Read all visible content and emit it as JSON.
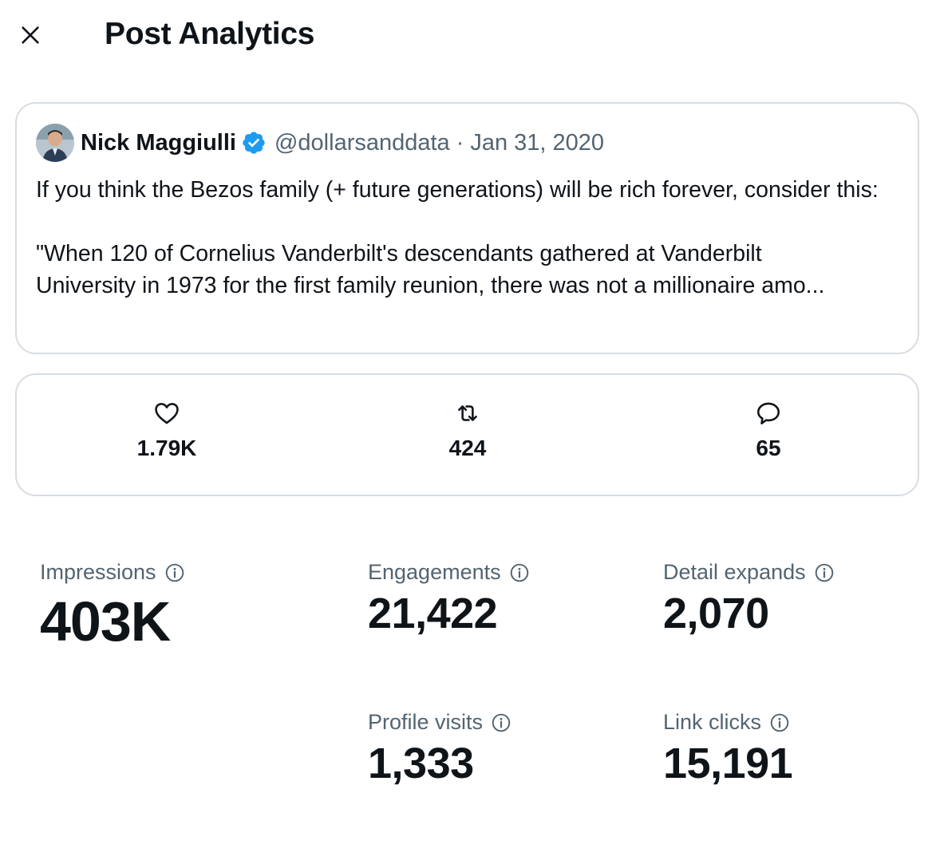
{
  "header": {
    "title": "Post Analytics",
    "close_icon": "close-icon"
  },
  "post": {
    "author_name": "Nick Maggiulli",
    "handle": "@dollarsanddata",
    "separator": "·",
    "date": "Jan 31, 2020",
    "verified_color": "#1d9bf0",
    "paragraph1": "If you think the Bezos family (+ future generations) will be rich forever, consider this:",
    "paragraph2_line1": "\"When 120 of Cornelius Vanderbilt's descendants gathered at Vanderbilt",
    "paragraph2_line2": "University in 1973 for the first family reunion, there was not a millionaire amo..."
  },
  "engagement": {
    "likes": "1.79K",
    "reposts": "424",
    "replies": "65"
  },
  "stats": {
    "impressions_label": "Impressions",
    "impressions_value": "403K",
    "engagements_label": "Engagements",
    "engagements_value": "21,422",
    "detail_expands_label": "Detail expands",
    "detail_expands_value": "2,070",
    "profile_visits_label": "Profile visits",
    "profile_visits_value": "1,333",
    "link_clicks_label": "Link clicks",
    "link_clicks_value": "15,191"
  }
}
